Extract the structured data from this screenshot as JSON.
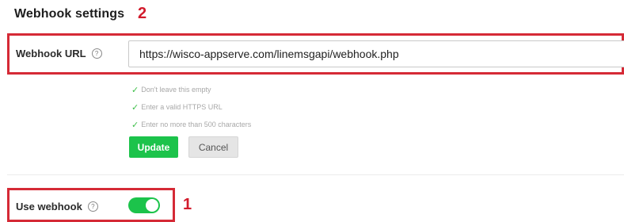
{
  "section": {
    "title": "Webhook settings"
  },
  "annotations": {
    "url_number": "2",
    "toggle_number": "1",
    "color": "#d21b2c"
  },
  "webhook_url": {
    "label": "Webhook URL",
    "help_icon": "?",
    "value": "https://wisco-appserve.com/linemsgapi/webhook.php"
  },
  "validation": {
    "check_icon": "✓",
    "rules": [
      "Don't leave this empty",
      "Enter a valid HTTPS URL",
      "Enter no more than 500 characters"
    ]
  },
  "buttons": {
    "update": "Update",
    "cancel": "Cancel"
  },
  "use_webhook": {
    "label": "Use webhook",
    "help_icon": "?",
    "enabled": true
  },
  "colors": {
    "accent_green": "#1cc34b",
    "annotation_red": "#d52a36"
  }
}
